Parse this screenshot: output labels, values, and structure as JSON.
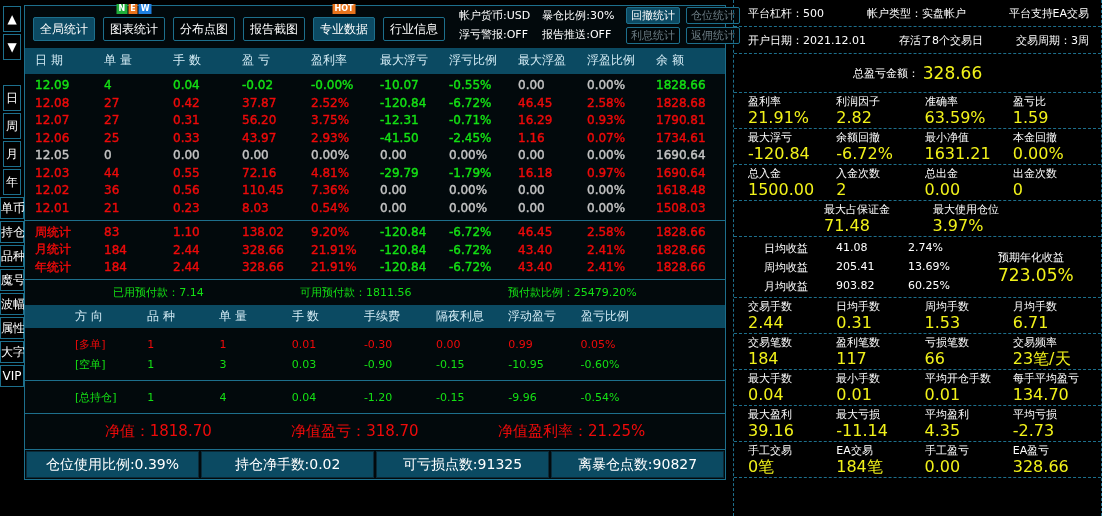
{
  "nav": {
    "up": "▲",
    "down": "▼",
    "items": [
      "日",
      "周",
      "月",
      "年",
      "单币",
      "持仓",
      "品种",
      "魔号",
      "波幅",
      "属性",
      "大字",
      "VIP"
    ]
  },
  "toolbar": {
    "buttons": [
      {
        "label": "全局统计",
        "selected": true
      },
      {
        "label": "图表统计",
        "selected": false,
        "badge": {
          "kind": "new",
          "letters": [
            "N",
            "E",
            "W"
          ]
        }
      },
      {
        "label": "分布点图",
        "selected": false
      },
      {
        "label": "报告截图",
        "selected": false
      },
      {
        "label": "专业数据",
        "selected": true,
        "badge": {
          "kind": "hot",
          "letters": [
            "HOT"
          ]
        }
      },
      {
        "label": "行业信息",
        "selected": false
      }
    ],
    "info": [
      "帐户货币:USD",
      "暴仓比例:30%",
      "浮亏警报:OFF",
      "报告推送:OFF"
    ],
    "small_buttons": [
      {
        "label": "回撤统计",
        "disabled": false
      },
      {
        "label": "仓位统计",
        "disabled": true
      },
      {
        "label": "利息统计",
        "disabled": true
      },
      {
        "label": "返佣统计",
        "disabled": true
      }
    ]
  },
  "daily_table": {
    "columns": [
      "日 期",
      "单 量",
      "手 数",
      "盈 亏",
      "盈利率",
      "最大浮亏",
      "浮亏比例",
      "最大浮盈",
      "浮盈比例",
      "余 额"
    ],
    "rows": [
      [
        {
          "text": "12.09",
          "color": "#14e014"
        },
        {
          "text": "4",
          "color": "#14e014"
        },
        {
          "text": "0.04",
          "color": "#14e014"
        },
        {
          "text": "-0.02",
          "color": "#14e014"
        },
        {
          "text": "-0.00%",
          "color": "#14e014"
        },
        {
          "text": "-10.07",
          "color": "#14e014"
        },
        {
          "text": "-0.55%",
          "color": "#14e014"
        },
        {
          "text": "0.00",
          "color": "#c4c4c4"
        },
        {
          "text": "0.00%",
          "color": "#c4c4c4"
        },
        {
          "text": "1828.66",
          "color": "#14e014"
        }
      ],
      [
        {
          "text": "12.08",
          "color": "#ee0a0a"
        },
        {
          "text": "27",
          "color": "#ee0a0a"
        },
        {
          "text": "0.42",
          "color": "#ee0a0a"
        },
        {
          "text": "37.87",
          "color": "#ee0a0a"
        },
        {
          "text": "2.52%",
          "color": "#ee0a0a"
        },
        {
          "text": "-120.84",
          "color": "#14e014"
        },
        {
          "text": "-6.72%",
          "color": "#14e014"
        },
        {
          "text": "46.45",
          "color": "#ee0a0a"
        },
        {
          "text": "2.58%",
          "color": "#ee0a0a"
        },
        {
          "text": "1828.68",
          "color": "#ee0a0a"
        }
      ],
      [
        {
          "text": "12.07",
          "color": "#ee0a0a"
        },
        {
          "text": "27",
          "color": "#ee0a0a"
        },
        {
          "text": "0.31",
          "color": "#ee0a0a"
        },
        {
          "text": "56.20",
          "color": "#ee0a0a"
        },
        {
          "text": "3.75%",
          "color": "#ee0a0a"
        },
        {
          "text": "-12.31",
          "color": "#14e014"
        },
        {
          "text": "-0.71%",
          "color": "#14e014"
        },
        {
          "text": "16.29",
          "color": "#ee0a0a"
        },
        {
          "text": "0.93%",
          "color": "#ee0a0a"
        },
        {
          "text": "1790.81",
          "color": "#ee0a0a"
        }
      ],
      [
        {
          "text": "12.06",
          "color": "#ee0a0a"
        },
        {
          "text": "25",
          "color": "#ee0a0a"
        },
        {
          "text": "0.33",
          "color": "#ee0a0a"
        },
        {
          "text": "43.97",
          "color": "#ee0a0a"
        },
        {
          "text": "2.93%",
          "color": "#ee0a0a"
        },
        {
          "text": "-41.50",
          "color": "#14e014"
        },
        {
          "text": "-2.45%",
          "color": "#14e014"
        },
        {
          "text": "1.16",
          "color": "#ee0a0a"
        },
        {
          "text": "0.07%",
          "color": "#ee0a0a"
        },
        {
          "text": "1734.61",
          "color": "#ee0a0a"
        }
      ],
      [
        {
          "text": "12.05",
          "color": "#c4c4c4"
        },
        {
          "text": "0",
          "color": "#c4c4c4"
        },
        {
          "text": "0.00",
          "color": "#c4c4c4"
        },
        {
          "text": "0.00",
          "color": "#c4c4c4"
        },
        {
          "text": "0.00%",
          "color": "#c4c4c4"
        },
        {
          "text": "0.00",
          "color": "#c4c4c4"
        },
        {
          "text": "0.00%",
          "color": "#c4c4c4"
        },
        {
          "text": "0.00",
          "color": "#c4c4c4"
        },
        {
          "text": "0.00%",
          "color": "#c4c4c4"
        },
        {
          "text": "1690.64",
          "color": "#c4c4c4"
        }
      ],
      [
        {
          "text": "12.03",
          "color": "#ee0a0a"
        },
        {
          "text": "44",
          "color": "#ee0a0a"
        },
        {
          "text": "0.55",
          "color": "#ee0a0a"
        },
        {
          "text": "72.16",
          "color": "#ee0a0a"
        },
        {
          "text": "4.81%",
          "color": "#ee0a0a"
        },
        {
          "text": "-29.79",
          "color": "#14e014"
        },
        {
          "text": "-1.79%",
          "color": "#14e014"
        },
        {
          "text": "16.18",
          "color": "#ee0a0a"
        },
        {
          "text": "0.97%",
          "color": "#ee0a0a"
        },
        {
          "text": "1690.64",
          "color": "#ee0a0a"
        }
      ],
      [
        {
          "text": "12.02",
          "color": "#ee0a0a"
        },
        {
          "text": "36",
          "color": "#ee0a0a"
        },
        {
          "text": "0.56",
          "color": "#ee0a0a"
        },
        {
          "text": "110.45",
          "color": "#ee0a0a"
        },
        {
          "text": "7.36%",
          "color": "#ee0a0a"
        },
        {
          "text": "0.00",
          "color": "#c4c4c4"
        },
        {
          "text": "0.00%",
          "color": "#c4c4c4"
        },
        {
          "text": "0.00",
          "color": "#c4c4c4"
        },
        {
          "text": "0.00%",
          "color": "#c4c4c4"
        },
        {
          "text": "1618.48",
          "color": "#ee0a0a"
        }
      ],
      [
        {
          "text": "12.01",
          "color": "#ee0a0a"
        },
        {
          "text": "21",
          "color": "#ee0a0a"
        },
        {
          "text": "0.23",
          "color": "#ee0a0a"
        },
        {
          "text": "8.03",
          "color": "#ee0a0a"
        },
        {
          "text": "0.54%",
          "color": "#ee0a0a"
        },
        {
          "text": "0.00",
          "color": "#c4c4c4"
        },
        {
          "text": "0.00%",
          "color": "#c4c4c4"
        },
        {
          "text": "0.00",
          "color": "#c4c4c4"
        },
        {
          "text": "0.00%",
          "color": "#c4c4c4"
        },
        {
          "text": "1508.03",
          "color": "#ee0a0a"
        }
      ]
    ],
    "summary_rows": [
      [
        {
          "text": "周统计",
          "color": "#ee0a0a"
        },
        {
          "text": "83",
          "color": "#ee0a0a"
        },
        {
          "text": "1.10",
          "color": "#ee0a0a"
        },
        {
          "text": "138.02",
          "color": "#ee0a0a"
        },
        {
          "text": "9.20%",
          "color": "#ee0a0a"
        },
        {
          "text": "-120.84",
          "color": "#14e014"
        },
        {
          "text": "-6.72%",
          "color": "#14e014"
        },
        {
          "text": "46.45",
          "color": "#ee0a0a"
        },
        {
          "text": "2.58%",
          "color": "#ee0a0a"
        },
        {
          "text": "1828.66",
          "color": "#ee0a0a"
        }
      ],
      [
        {
          "text": "月统计",
          "color": "#ee0a0a"
        },
        {
          "text": "184",
          "color": "#ee0a0a"
        },
        {
          "text": "2.44",
          "color": "#ee0a0a"
        },
        {
          "text": "328.66",
          "color": "#ee0a0a"
        },
        {
          "text": "21.91%",
          "color": "#ee0a0a"
        },
        {
          "text": "-120.84",
          "color": "#14e014"
        },
        {
          "text": "-6.72%",
          "color": "#14e014"
        },
        {
          "text": "43.40",
          "color": "#ee0a0a"
        },
        {
          "text": "2.41%",
          "color": "#ee0a0a"
        },
        {
          "text": "1828.66",
          "color": "#ee0a0a"
        }
      ],
      [
        {
          "text": "年统计",
          "color": "#ee0a0a"
        },
        {
          "text": "184",
          "color": "#ee0a0a"
        },
        {
          "text": "2.44",
          "color": "#ee0a0a"
        },
        {
          "text": "328.66",
          "color": "#ee0a0a"
        },
        {
          "text": "21.91%",
          "color": "#ee0a0a"
        },
        {
          "text": "-120.84",
          "color": "#14e014"
        },
        {
          "text": "-6.72%",
          "color": "#14e014"
        },
        {
          "text": "43.40",
          "color": "#ee0a0a"
        },
        {
          "text": "2.41%",
          "color": "#ee0a0a"
        },
        {
          "text": "1828.66",
          "color": "#ee0a0a"
        }
      ]
    ]
  },
  "prepay": [
    "已用预付款：7.14",
    "可用预付款：1811.56",
    "预付款比例：25479.20%"
  ],
  "positions": {
    "columns": [
      "方 向",
      "品 种",
      "单 量",
      "手 数",
      "手续费",
      "隔夜利息",
      "浮动盈亏",
      "盈亏比例"
    ],
    "rows": [
      {
        "color": "#ee0a0a",
        "cells": [
          "[多单]",
          "1",
          "1",
          "0.01",
          "-0.30",
          "0.00",
          "0.99",
          "0.05%"
        ]
      },
      {
        "color": "#14e014",
        "cells": [
          "[空单]",
          "1",
          "3",
          "0.03",
          "-0.90",
          "-0.15",
          "-10.95",
          "-0.60%"
        ]
      }
    ],
    "total": {
      "color": "#14e014",
      "cells": [
        "[总持仓]",
        "1",
        "4",
        "0.04",
        "-1.20",
        "-0.15",
        "-9.96",
        "-0.54%"
      ]
    }
  },
  "net": [
    "净值：1818.70",
    "净值盈亏：318.70",
    "净值盈利率：21.25%"
  ],
  "footer": [
    "仓位使用比例:0.39%",
    "持仓净手数:0.02",
    "可亏损点数:91325",
    "离暴仓点数:90827"
  ],
  "stats": {
    "info_rows": [
      [
        "平台杠杆：500",
        "帐户类型：实盘帐户",
        "平台支持EA交易"
      ],
      [
        "开户日期：2021.12.01",
        "存活了8个交易日",
        "交易周期：3周"
      ]
    ],
    "total": {
      "label": "总盈亏金额：",
      "value": "328.66"
    },
    "groups_top": [
      [
        {
          "label": "盈利率",
          "value": "21.91%"
        },
        {
          "label": "利润因子",
          "value": "2.82"
        },
        {
          "label": "准确率",
          "value": "63.59%"
        },
        {
          "label": "盈亏比",
          "value": "1.59"
        }
      ],
      [
        {
          "label": "最大浮亏",
          "value": "-120.84"
        },
        {
          "label": "余额回撤",
          "value": "-6.72%"
        },
        {
          "label": "最小净值",
          "value": "1631.21"
        },
        {
          "label": "本金回撤",
          "value": "0.00%"
        }
      ],
      [
        {
          "label": "总入金",
          "value": "1500.00"
        },
        {
          "label": "入金次数",
          "value": "2"
        },
        {
          "label": "总出金",
          "value": "0.00"
        },
        {
          "label": "出金次数",
          "value": "0"
        }
      ],
      [
        {
          "label": "最大占保证金",
          "value": "71.48"
        },
        {
          "label": "最大使用仓位",
          "value": "3.97%"
        }
      ]
    ],
    "averages": {
      "rows": [
        [
          "日均收益",
          "41.08",
          "2.74%"
        ],
        [
          "周均收益",
          "205.41",
          "13.69%"
        ],
        [
          "月均收益",
          "903.82",
          "60.25%"
        ]
      ],
      "annual_label": "预期年化收益",
      "annual_value": "723.05%"
    },
    "groups_bottom": [
      [
        {
          "label": "交易手数",
          "value": "2.44"
        },
        {
          "label": "日均手数",
          "value": "0.31"
        },
        {
          "label": "周均手数",
          "value": "1.53"
        },
        {
          "label": "月均手数",
          "value": "6.71"
        }
      ],
      [
        {
          "label": "交易笔数",
          "value": "184"
        },
        {
          "label": "盈利笔数",
          "value": "117"
        },
        {
          "label": "亏损笔数",
          "value": "66"
        },
        {
          "label": "交易频率",
          "value": "23笔/天"
        }
      ],
      [
        {
          "label": "最大手数",
          "value": "0.04"
        },
        {
          "label": "最小手数",
          "value": "0.01"
        },
        {
          "label": "平均开仓手数",
          "value": "0.01"
        },
        {
          "label": "每手平均盈亏",
          "value": "134.70"
        }
      ],
      [
        {
          "label": "最大盈利",
          "value": "39.16"
        },
        {
          "label": "最大亏损",
          "value": "-11.14"
        },
        {
          "label": "平均盈利",
          "value": "4.35"
        },
        {
          "label": "平均亏损",
          "value": "-2.73"
        }
      ],
      [
        {
          "label": "手工交易",
          "value": "0笔"
        },
        {
          "label": "EA交易",
          "value": "184笔"
        },
        {
          "label": "手工盈亏",
          "value": "0.00"
        },
        {
          "label": "EA盈亏",
          "value": "328.66"
        }
      ]
    ]
  }
}
